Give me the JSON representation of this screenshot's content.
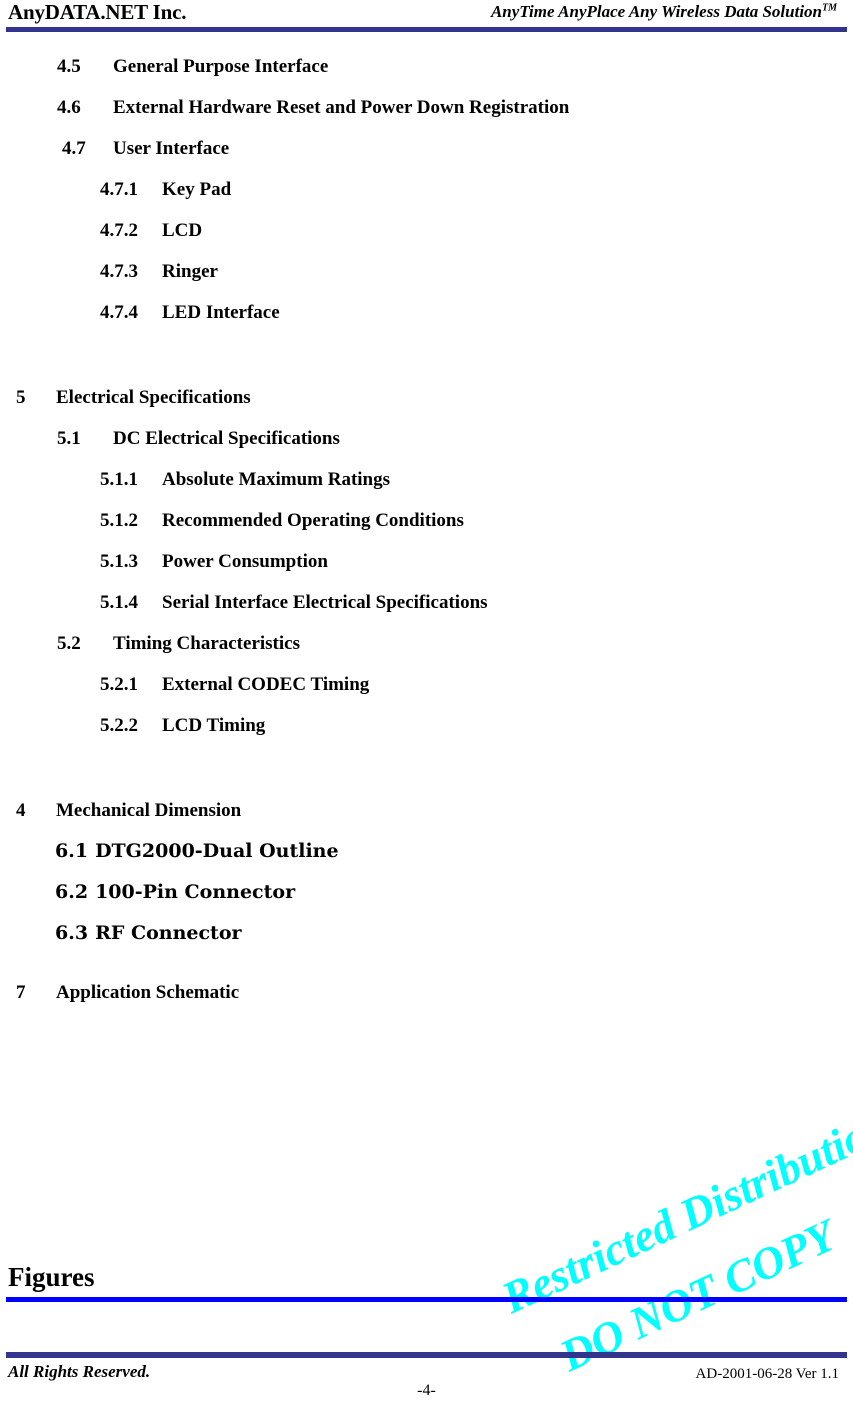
{
  "header": {
    "company": "AnyDATA.NET Inc.",
    "tagline": "AnyTime AnyPlace Any Wireless Data Solution",
    "tagline_superscript": "TM",
    "rule_color": "#33348E"
  },
  "toc": {
    "entries": [
      {
        "num": "4.5",
        "label": "General Purpose Interface",
        "level": "sub"
      },
      {
        "num": "4.6",
        "label": "External Hardware Reset and Power Down Registration",
        "level": "sub"
      },
      {
        "num": "4.7",
        "label": "User Interface",
        "level": "sub-b"
      },
      {
        "num": "4.7.1",
        "label": "Key Pad",
        "level": "ssub"
      },
      {
        "num": "4.7.2",
        "label": "LCD",
        "level": "ssub"
      },
      {
        "num": "4.7.3",
        "label": "Ringer",
        "level": "ssub"
      },
      {
        "num": "4.7.4",
        "label": "LED Interface",
        "level": "ssub"
      },
      {
        "num": "5",
        "label": "Electrical Specifications",
        "level": "sec"
      },
      {
        "num": "5.1",
        "label": "DC Electrical Specifications",
        "level": "sub"
      },
      {
        "num": "5.1.1",
        "label": "Absolute Maximum Ratings",
        "level": "ssub"
      },
      {
        "num": "5.1.2",
        "label": "Recommended Operating Conditions",
        "level": "ssub"
      },
      {
        "num": "5.1.3",
        "label": "Power Consumption",
        "level": "ssub"
      },
      {
        "num": "5.1.4",
        "label": "Serial Interface Electrical Specifications",
        "level": "ssub"
      },
      {
        "num": "5.2",
        "label": "Timing Characteristics",
        "level": "sub"
      },
      {
        "num": "5.2.1",
        "label": "External CODEC Timing",
        "level": "ssub"
      },
      {
        "num": "5.2.2",
        "label": "LCD Timing",
        "level": "ssub"
      },
      {
        "num": "4",
        "label": "Mechanical Dimension",
        "level": "sec"
      },
      {
        "num": "6.1",
        "label": "DTG2000-Dual Outline",
        "level": "alt"
      },
      {
        "num": "6.2",
        "label": "100-Pin Connector",
        "level": "alt"
      },
      {
        "num": "6.3",
        "label": "RF Connector",
        "level": "alt"
      },
      {
        "num": "7",
        "label": "Application Schematic",
        "level": "sec"
      }
    ]
  },
  "watermark": {
    "line1": "Restricted Distribution",
    "line2": "DO NOT COPY",
    "color": "#00FFFF",
    "rotation_deg": -25
  },
  "figures": {
    "heading": "Figures",
    "rule_color": "#0000FF"
  },
  "footer": {
    "left": "All Rights Reserved.",
    "page_number": "-4-",
    "right": "AD-2001-06-28 Ver 1.1",
    "rule_color": "#33348E"
  }
}
